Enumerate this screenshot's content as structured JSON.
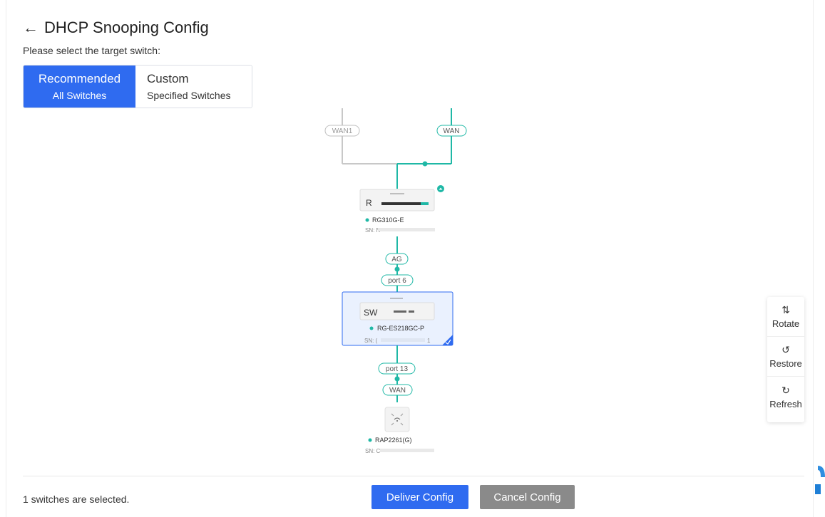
{
  "header": {
    "back_icon": "←",
    "title": "DHCP Snooping Config"
  },
  "instruction": "Please select the target switch:",
  "scope_selector": {
    "recommended": {
      "label": "Recommended",
      "sublabel": "All Switches",
      "active": true
    },
    "custom": {
      "label": "Custom",
      "sublabel": "Specified Switches",
      "active": false
    }
  },
  "topology": {
    "links": {
      "wan1": "WAN1",
      "wan": "WAN",
      "ag": "AG",
      "port6": "port 6",
      "port13": "port 13",
      "ap_wan": "WAN"
    },
    "devices": {
      "router": {
        "badge": "R",
        "name": "RG310G-E",
        "sn": "SN: N",
        "status_color": "#1fb8a6"
      },
      "switch": {
        "badge": "SW",
        "name": "RG-ES218GC-P",
        "sn": "SN: (",
        "sn_tail": "1",
        "selected": true,
        "status_color": "#1fb8a6"
      },
      "ap": {
        "name": "RAP2261(G)",
        "sn": "SN: C",
        "status_color": "#1fb8a6"
      }
    },
    "colors": {
      "active_link": "#1fb8a6",
      "inactive_link": "#bfbfbf",
      "selection": "#2f6bf0"
    }
  },
  "toolbar": {
    "rotate": {
      "icon": "rotate-icon",
      "label": "Rotate"
    },
    "restore": {
      "icon": "restore-icon",
      "label": "Restore"
    },
    "refresh": {
      "icon": "refresh-icon",
      "label": "Refresh"
    }
  },
  "footer": {
    "selection_status": "1 switches are selected.",
    "deliver_label": "Deliver Config",
    "cancel_label": "Cancel Config"
  }
}
